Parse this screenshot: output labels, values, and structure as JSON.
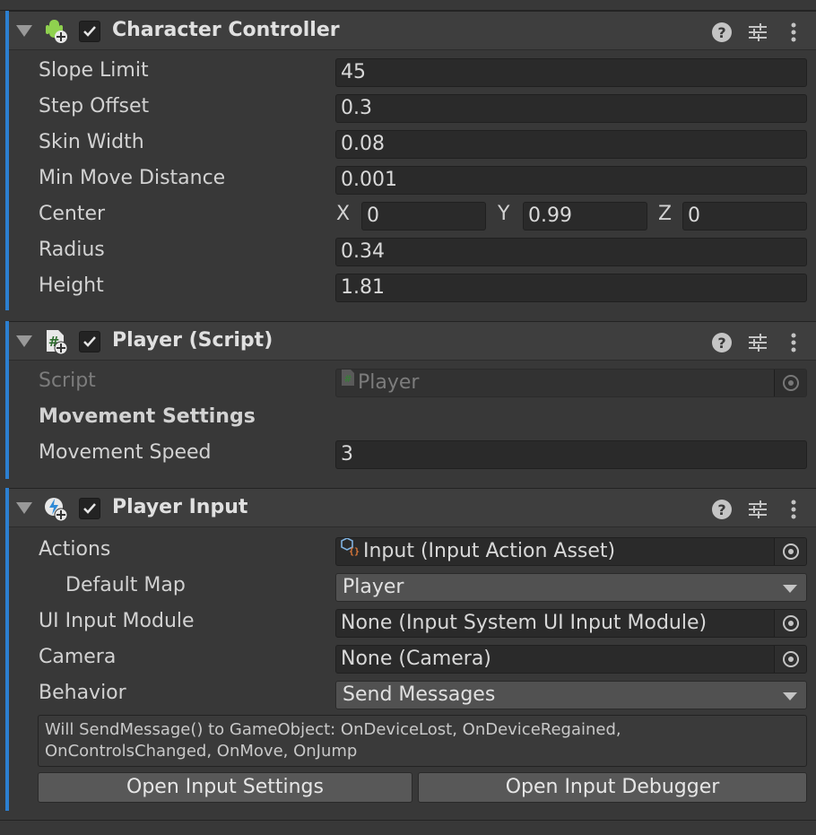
{
  "colors": {
    "accent": "#2c7fd0",
    "panel": "#383838",
    "header": "#3e3e3e",
    "field": "#2a2a2a"
  },
  "character_controller": {
    "title": "Character Controller",
    "icon": "character-controller-icon",
    "enabled": true,
    "fields": [
      {
        "label": "Slope Limit",
        "value": "45"
      },
      {
        "label": "Step Offset",
        "value": "0.3"
      },
      {
        "label": "Skin Width",
        "value": "0.08"
      },
      {
        "label": "Min Move Distance",
        "value": "0.001"
      },
      {
        "label": "Center",
        "x_label": "X",
        "x": "0",
        "y_label": "Y",
        "y": "0.99",
        "z_label": "Z",
        "z": "0"
      },
      {
        "label": "Radius",
        "value": "0.34"
      },
      {
        "label": "Height",
        "value": "1.81"
      }
    ]
  },
  "player_script": {
    "title": "Player (Script)",
    "icon": "csharp-script-icon",
    "enabled": true,
    "script_label": "Script",
    "script_value": "Player",
    "section_heading": "Movement Settings",
    "movement_speed_label": "Movement Speed",
    "movement_speed_value": "3"
  },
  "player_input": {
    "title": "Player Input",
    "icon": "player-input-icon",
    "enabled": true,
    "actions_label": "Actions",
    "actions_value": "Input (Input Action Asset)",
    "default_map_label": "Default Map",
    "default_map_value": "Player",
    "ui_input_module_label": "UI Input Module",
    "ui_input_module_value": "None (Input System UI Input Module)",
    "camera_label": "Camera",
    "camera_value": "None (Camera)",
    "behavior_label": "Behavior",
    "behavior_value": "Send Messages",
    "help_line1": "Will SendMessage() to GameObject: OnDeviceLost, OnDeviceRegained,",
    "help_line2": "OnControlsChanged, OnMove, OnJump",
    "open_settings_label": "Open Input Settings",
    "open_debugger_label": "Open Input Debugger"
  },
  "header_icons": [
    "help-icon",
    "presets-icon",
    "more-options-icon"
  ]
}
